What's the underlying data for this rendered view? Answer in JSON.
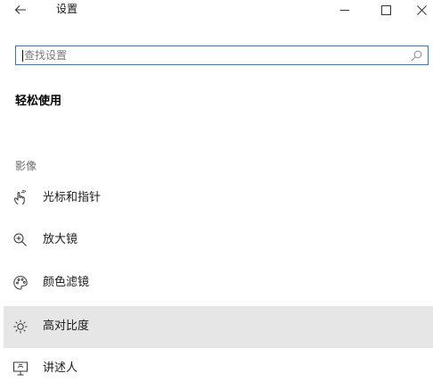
{
  "window": {
    "title": "设置",
    "back_icon": "arrow-left-icon",
    "minimize_icon": "minimize-icon",
    "maximize_icon": "maximize-icon",
    "close_icon": "close-icon"
  },
  "search": {
    "placeholder": "查找设置",
    "value": "",
    "icon": "search-icon",
    "border_color": "#2a7cc7"
  },
  "page": {
    "heading": "轻松使用",
    "group_label": "影像"
  },
  "nav": {
    "items": [
      {
        "label": "光标和指针",
        "icon": "pointer-hand-icon",
        "selected": false
      },
      {
        "label": "放大镜",
        "icon": "magnifier-zoom-icon",
        "selected": false
      },
      {
        "label": "颜色滤镜",
        "icon": "color-palette-icon",
        "selected": false
      },
      {
        "label": "高对比度",
        "icon": "brightness-icon",
        "selected": true
      },
      {
        "label": "讲述人",
        "icon": "narrator-icon",
        "selected": false
      }
    ],
    "selected_background": "#e6e6e6"
  }
}
